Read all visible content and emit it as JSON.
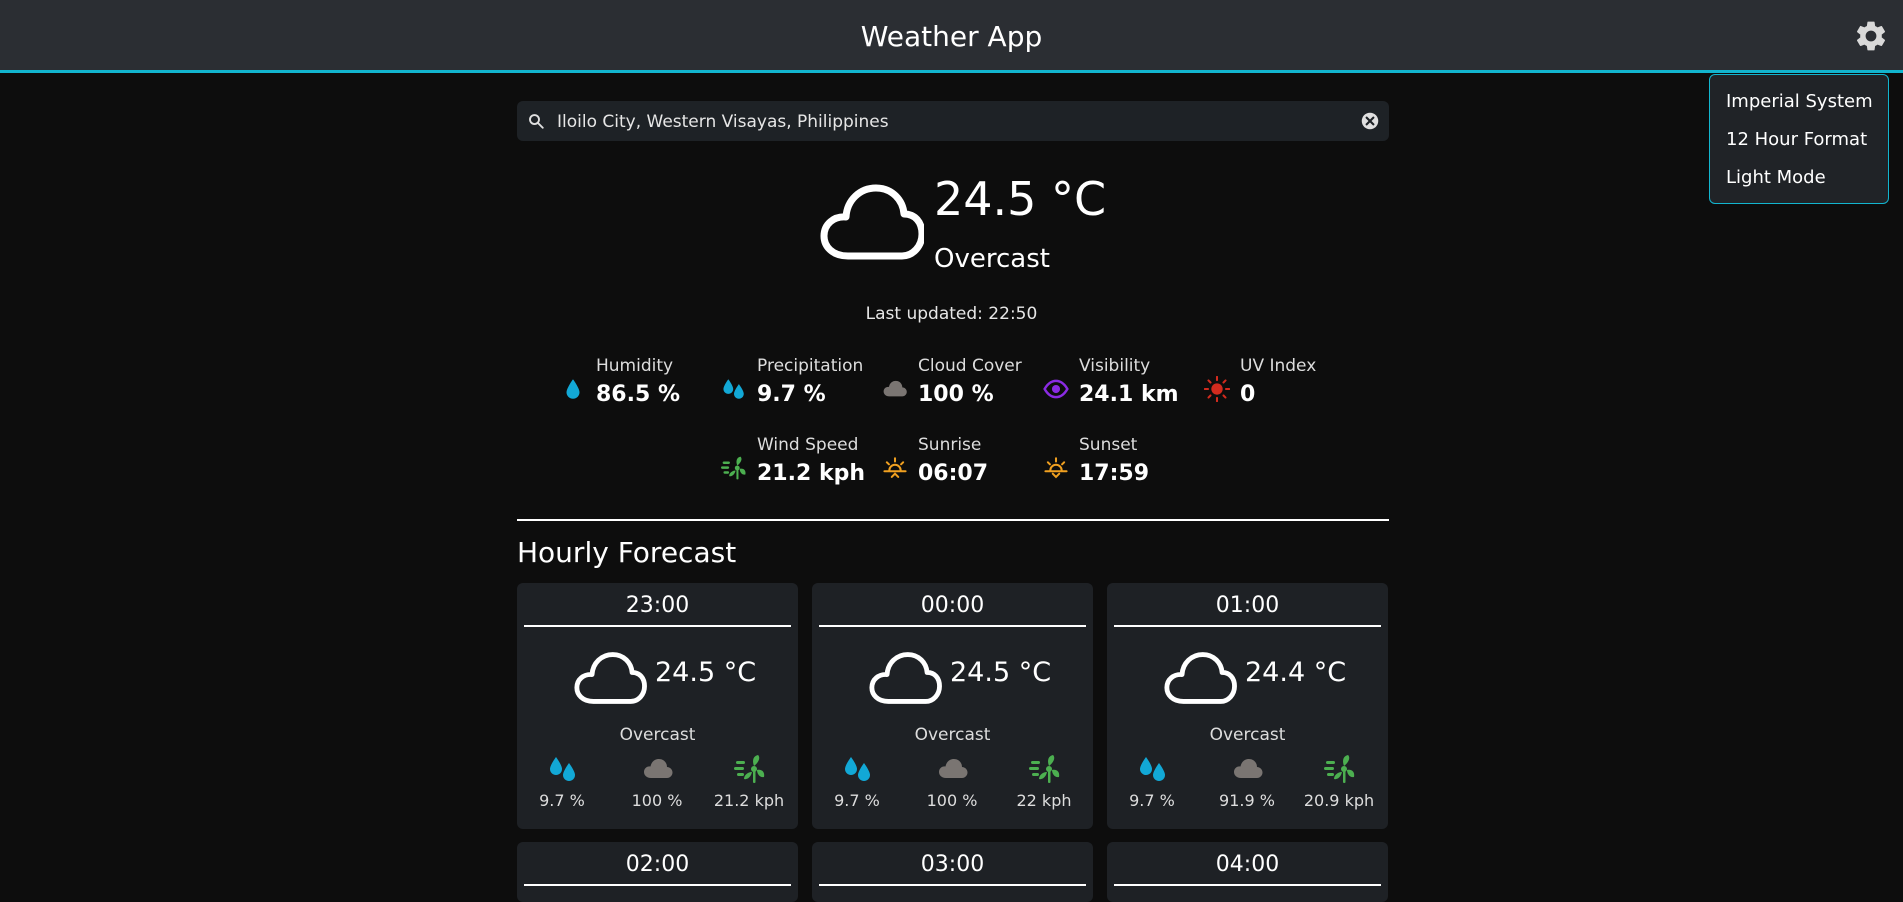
{
  "header": {
    "title": "Weather App",
    "settings_icon": "gear-icon"
  },
  "settings_menu": {
    "options": [
      "Imperial System",
      "12 Hour Format",
      "Light Mode"
    ]
  },
  "search": {
    "value": "Iloilo City, Western Visayas, Philippines",
    "search_icon": "search-icon",
    "clear_icon": "clear-icon"
  },
  "current": {
    "icon": "cloud-icon",
    "temperature": "24.5 °C",
    "condition": "Overcast",
    "last_updated": "Last updated: 22:50"
  },
  "stats": {
    "humidity": {
      "label": "Humidity",
      "value": "86.5 %",
      "icon": "droplet-icon"
    },
    "precipitation": {
      "label": "Precipitation",
      "value": "9.7 %",
      "icon": "droplets-icon"
    },
    "cloud_cover": {
      "label": "Cloud Cover",
      "value": "100 %",
      "icon": "cloud-icon"
    },
    "visibility": {
      "label": "Visibility",
      "value": "24.1 km",
      "icon": "eye-icon"
    },
    "uv_index": {
      "label": "UV Index",
      "value": "0",
      "icon": "sun-icon"
    },
    "wind_speed": {
      "label": "Wind Speed",
      "value": "21.2 kph",
      "icon": "wind-icon"
    },
    "sunrise": {
      "label": "Sunrise",
      "value": "06:07",
      "icon": "sunrise-icon"
    },
    "sunset": {
      "label": "Sunset",
      "value": "17:59",
      "icon": "sunset-icon"
    }
  },
  "hourly": {
    "title": "Hourly Forecast",
    "cards": [
      {
        "time": "23:00",
        "temp": "24.5 °C",
        "condition": "Overcast",
        "precip": "9.7 %",
        "cloud": "100 %",
        "wind": "21.2 kph"
      },
      {
        "time": "00:00",
        "temp": "24.5 °C",
        "condition": "Overcast",
        "precip": "9.7 %",
        "cloud": "100 %",
        "wind": "22 kph"
      },
      {
        "time": "01:00",
        "temp": "24.4 °C",
        "condition": "Overcast",
        "precip": "9.7 %",
        "cloud": "91.9 %",
        "wind": "20.9 kph"
      },
      {
        "time": "02:00"
      },
      {
        "time": "03:00"
      },
      {
        "time": "04:00"
      }
    ]
  },
  "colors": {
    "accent": "#12b5cf",
    "water": "#12a8d6",
    "cloud_gray": "#7a7572",
    "eye": "#8a2be2",
    "uv": "#d22b1e",
    "wind": "#4caf50",
    "sun": "#f0a020"
  }
}
